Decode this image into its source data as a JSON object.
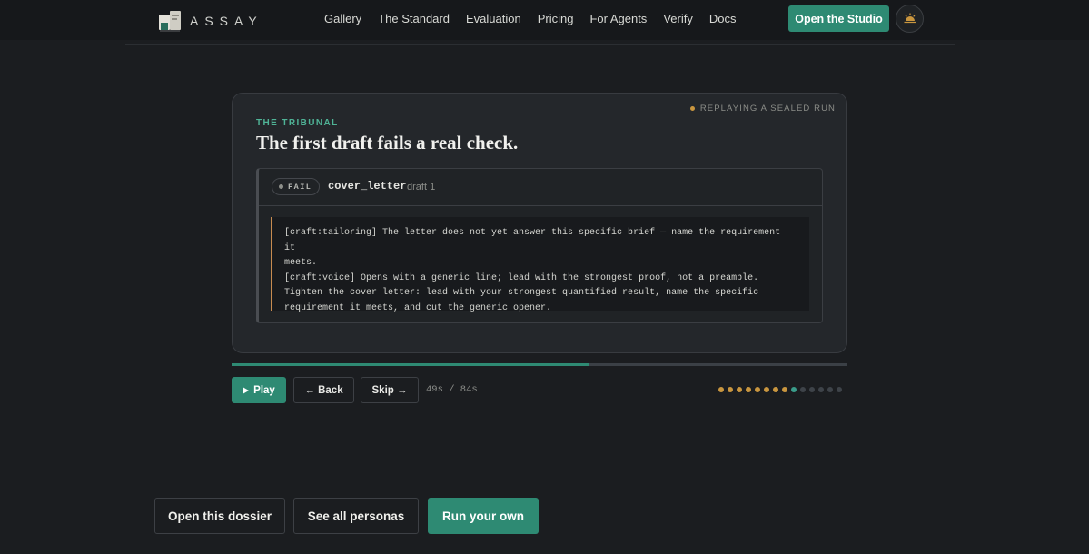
{
  "nav": {
    "brand": "ASSAY",
    "links": [
      "Gallery",
      "The Standard",
      "Evaluation",
      "Pricing",
      "For Agents",
      "Verify",
      "Docs"
    ],
    "studio_button": "Open the Studio",
    "theme_icon": "sun-icon"
  },
  "card": {
    "replay_label": "REPLAYING A SEALED RUN",
    "eyebrow": "THE TRIBUNAL",
    "headline": "The first draft fails a real check.",
    "verdict": {
      "status": "FAIL",
      "target": "cover_letter",
      "draft": "draft 1",
      "critique": [
        "[craft:tailoring] The letter does not yet answer this specific brief — name the requirement it",
        "meets.",
        "[craft:voice] Opens with a generic line; lead with the strongest proof, not a preamble.",
        "Tighten the cover letter: lead with your strongest quantified result, name the specific",
        "requirement it meets, and cut the generic opener."
      ]
    }
  },
  "player": {
    "progress": 0.58,
    "play_label": "Play",
    "back_label": "← Back",
    "skip_label": "Skip →",
    "timer": "49s / 84s",
    "steps_total": 14,
    "steps_completed": 8,
    "step_current": 9,
    "colors": {
      "completed": "#c9963f",
      "current": "#3a9c8a",
      "pending": "#3e4349"
    }
  },
  "cta": {
    "open_dossier": "Open this dossier",
    "see_personas": "See all personas",
    "run_own": "Run your own"
  }
}
